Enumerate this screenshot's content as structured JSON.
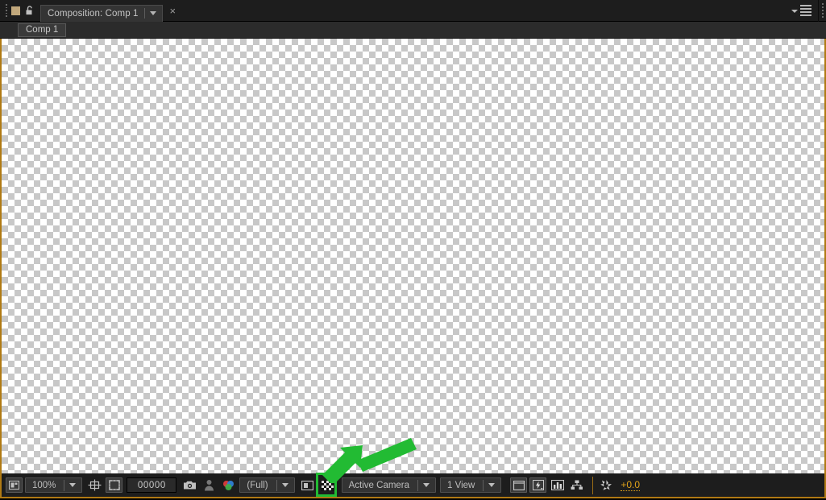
{
  "window": {
    "title_prefix": "Composition:",
    "title": "Composition: Comp 1",
    "close_label": "×"
  },
  "titlebar": {
    "grip_name": "panel-grip",
    "comp_color_swatch": "#c2a87c",
    "lock_icon": "lock-icon",
    "tab_dropdown_icon": "chevron-down-icon",
    "panel_menu_icon": "panel-menu-icon",
    "right_grip_icon": "panel-grip-icon"
  },
  "breadcrumb": {
    "items": [
      {
        "label": "Comp 1"
      }
    ]
  },
  "viewer": {
    "transparency_grid_enabled": true,
    "checker_light": "#ffffff",
    "checker_dark": "#c8c8c8",
    "panel_border_color": "#b07a14"
  },
  "toolbar": {
    "always_preview_icon": "always-preview-this-view-icon",
    "magnification": {
      "value": "100%",
      "dropdown_icon": "chevron-down-icon"
    },
    "grid_guides_icon": "choose-grid-and-guide-options-icon",
    "region_of_interest_icon": "region-of-interest-icon",
    "timecode": "00000",
    "snapshot_icon": "take-snapshot-icon",
    "show_snapshot_icon": "show-snapshot-icon",
    "channels_icon": "show-channel-and-color-management-icon",
    "resolution": {
      "value": "(Full)",
      "dropdown_icon": "chevron-down-icon"
    },
    "toggle_mask_icon": "toggle-mask-and-shape-path-visibility-icon",
    "transparency_grid": {
      "name": "toggle-transparency-grid",
      "icon": "checkerboard-icon",
      "highlighted": true,
      "highlight_color": "#22bb33"
    },
    "camera_view": {
      "value": "Active Camera",
      "dropdown_icon": "chevron-down-icon"
    },
    "view_layout": {
      "value": "1 View",
      "dropdown_icon": "chevron-down-icon"
    },
    "roi_icon": "region-of-interest-icon",
    "fast_previews_icon": "fast-previews-icon",
    "histogram_icon": "show-rgb-parade-icon",
    "flowchart_icon": "composition-flowchart-icon",
    "exposure_icon": "reset-exposure-icon",
    "exposure_value": "+0.0",
    "exposure_color": "#e0a21a"
  },
  "annotation": {
    "arrow": {
      "name": "green-pointer-arrow",
      "color": "#22bb33",
      "points_to": "toggle-transparency-grid"
    },
    "highlight_box": {
      "name": "green-highlight-box",
      "color": "#22bb33"
    }
  }
}
